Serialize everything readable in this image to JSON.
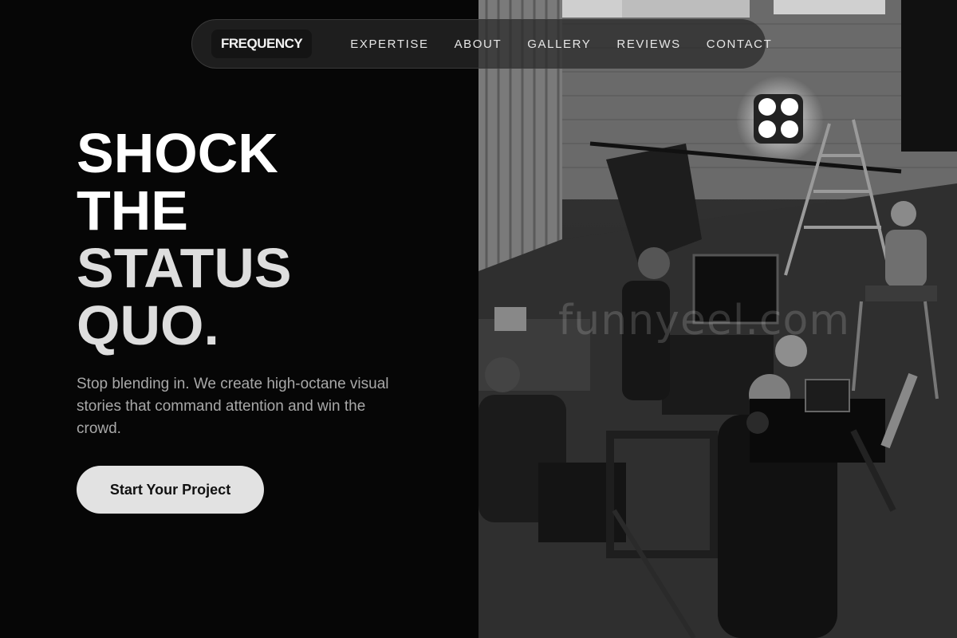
{
  "nav": {
    "logo": "FREQUENCY",
    "links": [
      "EXPERTISE",
      "ABOUT",
      "GALLERY",
      "REVIEWS",
      "CONTACT"
    ]
  },
  "hero": {
    "headline": [
      "SHOCK",
      "THE",
      "STATUS",
      "QUO."
    ],
    "subtitle": "Stop blending in. We create high-octane visual stories that command attention and win the crowd.",
    "cta_label": "Start Your Project"
  },
  "watermark": "funnyeel.com",
  "colors": {
    "background": "#060606",
    "headline": "#ffffff",
    "subtitle": "#a8a8a8",
    "button_bg": "#e2e2e2",
    "button_text": "#111111"
  }
}
